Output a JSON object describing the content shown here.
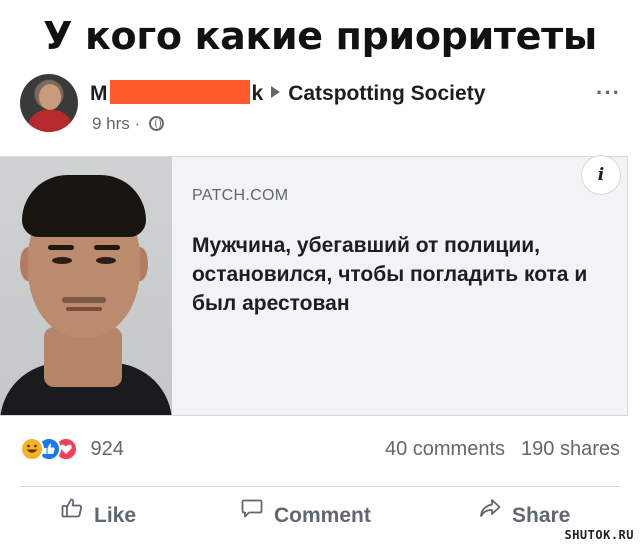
{
  "meme": {
    "title": "У кого какие приоритеты"
  },
  "post": {
    "author_visible_start": "M",
    "author_visible_end": "k",
    "group": "Catspotting Society",
    "time": "9 hrs",
    "separator": "·",
    "more_menu": "···",
    "privacy_icon": "globe-icon"
  },
  "link_card": {
    "source": "PATCH.COM",
    "headline": "Мужчина, убегавший от полиции, остановился, чтобы погладить кота и был арестован",
    "info_label": "i"
  },
  "engagement": {
    "reactions": [
      "haha",
      "like",
      "love"
    ],
    "reaction_count": "924",
    "comments": "40 comments",
    "shares": "190 shares"
  },
  "actions": {
    "like": "Like",
    "comment": "Comment",
    "share": "Share"
  },
  "watermark": "SHUTOK.RU",
  "colors": {
    "redaction": "#ff5a2c",
    "text_primary": "#1c1e21",
    "text_secondary": "#606770",
    "like_blue": "#1877f2",
    "love_red": "#f33e58",
    "haha_yellow": "#f7b125"
  }
}
